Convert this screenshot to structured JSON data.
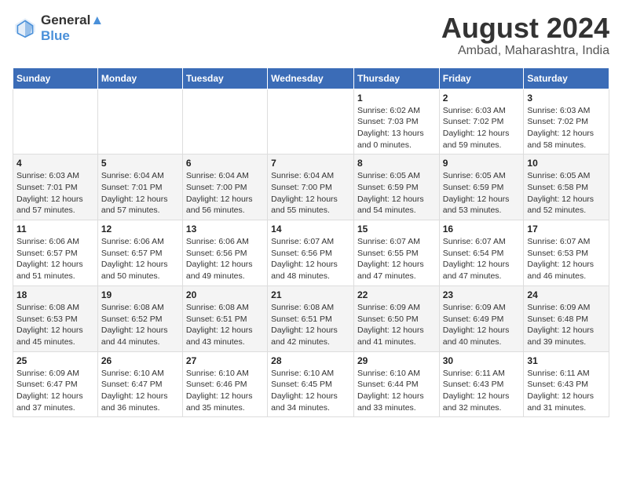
{
  "logo": {
    "line1": "General",
    "line2": "Blue"
  },
  "title": "August 2024",
  "subtitle": "Ambad, Maharashtra, India",
  "days_header": [
    "Sunday",
    "Monday",
    "Tuesday",
    "Wednesday",
    "Thursday",
    "Friday",
    "Saturday"
  ],
  "weeks": [
    [
      {
        "day": "",
        "info": ""
      },
      {
        "day": "",
        "info": ""
      },
      {
        "day": "",
        "info": ""
      },
      {
        "day": "",
        "info": ""
      },
      {
        "day": "1",
        "info": "Sunrise: 6:02 AM\nSunset: 7:03 PM\nDaylight: 13 hours\nand 0 minutes."
      },
      {
        "day": "2",
        "info": "Sunrise: 6:03 AM\nSunset: 7:02 PM\nDaylight: 12 hours\nand 59 minutes."
      },
      {
        "day": "3",
        "info": "Sunrise: 6:03 AM\nSunset: 7:02 PM\nDaylight: 12 hours\nand 58 minutes."
      }
    ],
    [
      {
        "day": "4",
        "info": "Sunrise: 6:03 AM\nSunset: 7:01 PM\nDaylight: 12 hours\nand 57 minutes."
      },
      {
        "day": "5",
        "info": "Sunrise: 6:04 AM\nSunset: 7:01 PM\nDaylight: 12 hours\nand 57 minutes."
      },
      {
        "day": "6",
        "info": "Sunrise: 6:04 AM\nSunset: 7:00 PM\nDaylight: 12 hours\nand 56 minutes."
      },
      {
        "day": "7",
        "info": "Sunrise: 6:04 AM\nSunset: 7:00 PM\nDaylight: 12 hours\nand 55 minutes."
      },
      {
        "day": "8",
        "info": "Sunrise: 6:05 AM\nSunset: 6:59 PM\nDaylight: 12 hours\nand 54 minutes."
      },
      {
        "day": "9",
        "info": "Sunrise: 6:05 AM\nSunset: 6:59 PM\nDaylight: 12 hours\nand 53 minutes."
      },
      {
        "day": "10",
        "info": "Sunrise: 6:05 AM\nSunset: 6:58 PM\nDaylight: 12 hours\nand 52 minutes."
      }
    ],
    [
      {
        "day": "11",
        "info": "Sunrise: 6:06 AM\nSunset: 6:57 PM\nDaylight: 12 hours\nand 51 minutes."
      },
      {
        "day": "12",
        "info": "Sunrise: 6:06 AM\nSunset: 6:57 PM\nDaylight: 12 hours\nand 50 minutes."
      },
      {
        "day": "13",
        "info": "Sunrise: 6:06 AM\nSunset: 6:56 PM\nDaylight: 12 hours\nand 49 minutes."
      },
      {
        "day": "14",
        "info": "Sunrise: 6:07 AM\nSunset: 6:56 PM\nDaylight: 12 hours\nand 48 minutes."
      },
      {
        "day": "15",
        "info": "Sunrise: 6:07 AM\nSunset: 6:55 PM\nDaylight: 12 hours\nand 47 minutes."
      },
      {
        "day": "16",
        "info": "Sunrise: 6:07 AM\nSunset: 6:54 PM\nDaylight: 12 hours\nand 47 minutes."
      },
      {
        "day": "17",
        "info": "Sunrise: 6:07 AM\nSunset: 6:53 PM\nDaylight: 12 hours\nand 46 minutes."
      }
    ],
    [
      {
        "day": "18",
        "info": "Sunrise: 6:08 AM\nSunset: 6:53 PM\nDaylight: 12 hours\nand 45 minutes."
      },
      {
        "day": "19",
        "info": "Sunrise: 6:08 AM\nSunset: 6:52 PM\nDaylight: 12 hours\nand 44 minutes."
      },
      {
        "day": "20",
        "info": "Sunrise: 6:08 AM\nSunset: 6:51 PM\nDaylight: 12 hours\nand 43 minutes."
      },
      {
        "day": "21",
        "info": "Sunrise: 6:08 AM\nSunset: 6:51 PM\nDaylight: 12 hours\nand 42 minutes."
      },
      {
        "day": "22",
        "info": "Sunrise: 6:09 AM\nSunset: 6:50 PM\nDaylight: 12 hours\nand 41 minutes."
      },
      {
        "day": "23",
        "info": "Sunrise: 6:09 AM\nSunset: 6:49 PM\nDaylight: 12 hours\nand 40 minutes."
      },
      {
        "day": "24",
        "info": "Sunrise: 6:09 AM\nSunset: 6:48 PM\nDaylight: 12 hours\nand 39 minutes."
      }
    ],
    [
      {
        "day": "25",
        "info": "Sunrise: 6:09 AM\nSunset: 6:47 PM\nDaylight: 12 hours\nand 37 minutes."
      },
      {
        "day": "26",
        "info": "Sunrise: 6:10 AM\nSunset: 6:47 PM\nDaylight: 12 hours\nand 36 minutes."
      },
      {
        "day": "27",
        "info": "Sunrise: 6:10 AM\nSunset: 6:46 PM\nDaylight: 12 hours\nand 35 minutes."
      },
      {
        "day": "28",
        "info": "Sunrise: 6:10 AM\nSunset: 6:45 PM\nDaylight: 12 hours\nand 34 minutes."
      },
      {
        "day": "29",
        "info": "Sunrise: 6:10 AM\nSunset: 6:44 PM\nDaylight: 12 hours\nand 33 minutes."
      },
      {
        "day": "30",
        "info": "Sunrise: 6:11 AM\nSunset: 6:43 PM\nDaylight: 12 hours\nand 32 minutes."
      },
      {
        "day": "31",
        "info": "Sunrise: 6:11 AM\nSunset: 6:43 PM\nDaylight: 12 hours\nand 31 minutes."
      }
    ]
  ]
}
